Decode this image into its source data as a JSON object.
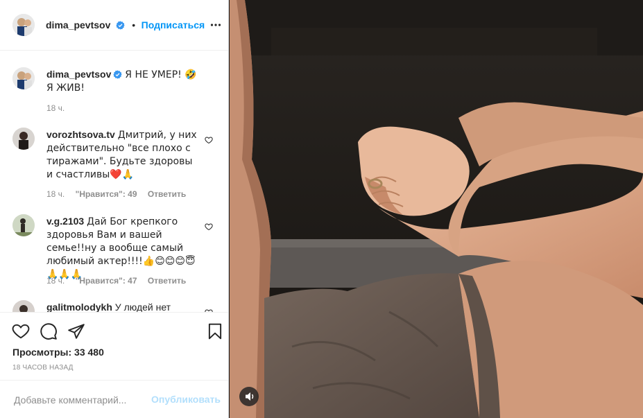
{
  "header": {
    "username": "dima_pevtsov",
    "dot": "•",
    "follow_label": "Подписаться"
  },
  "caption": {
    "username": "dima_pevtsov",
    "text": "Я НЕ УМЕР! 🤣 Я ЖИВ!",
    "time": "18 ч."
  },
  "comments": [
    {
      "username": "vorozhtsova.tv",
      "text": "Дмитрий, у них действительно \"все плохо с тиражами\". Будьте здоровы и счастливы❤️🙏",
      "time": "18 ч.",
      "likes": "\"Нравится\": 49",
      "reply": "Ответить"
    },
    {
      "username": "v.g.2103",
      "text": "Дай Бог крепкого здоровья Вам и вашей семье!!ну а вообще самый любимый актер!!!!👍😊😊😊😇🙏🙏🙏",
      "time": "18 ч.",
      "likes": "\"Нравится\": 47",
      "reply": "Ответить"
    },
    {
      "username": "galitmolodykh",
      "text": "У людей нет"
    }
  ],
  "stats": {
    "views": "Просмотры: 33 480",
    "ago": "18 ЧАСОВ НАЗАД"
  },
  "add_comment": {
    "placeholder": "Добавьте комментарий...",
    "publish_label": "Опубликовать"
  },
  "colors": {
    "accent": "#0095f6",
    "verified": "#3897f0",
    "muted": "#8e8e8e",
    "publish_disabled": "#b2dffc"
  },
  "icons": {
    "header_more": "more-options-icon",
    "like": "heart-icon",
    "comment": "comment-icon",
    "share": "share-icon",
    "save": "bookmark-icon",
    "sound": "sound-toggle-icon",
    "comment_like": "small-heart-icon"
  }
}
